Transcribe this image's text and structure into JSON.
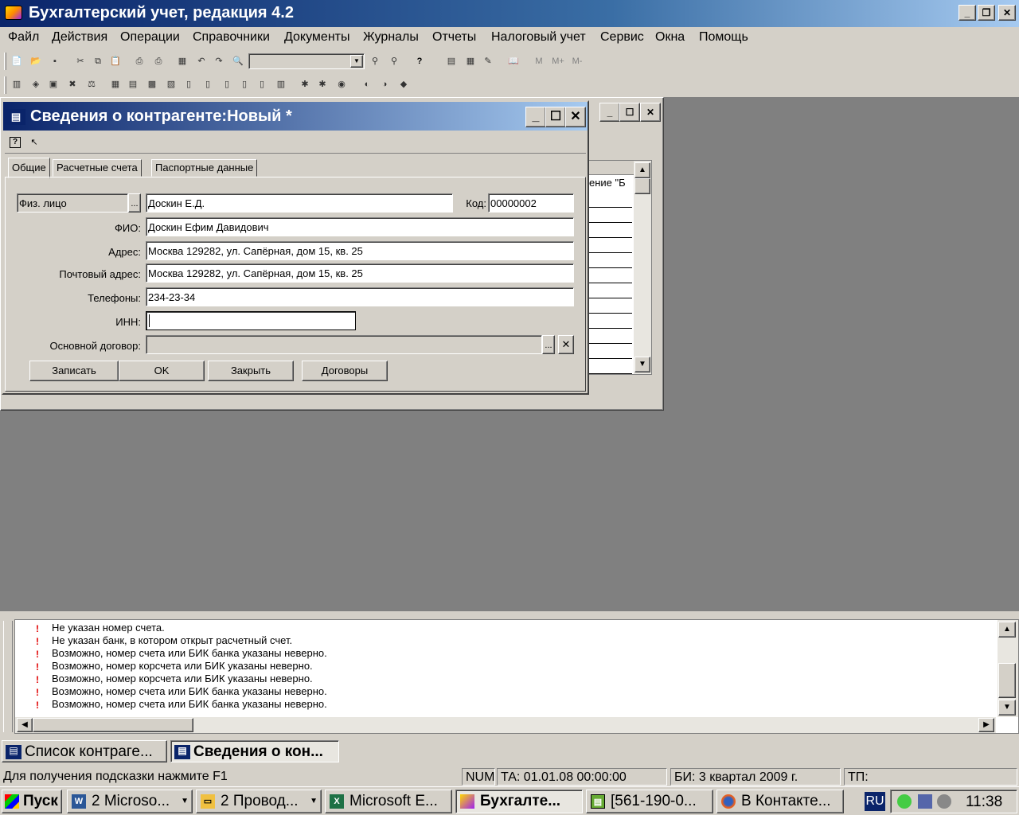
{
  "app": {
    "title": "Бухгалтерский учет, редакция 4.2"
  },
  "menu": [
    "Файл",
    "Действия",
    "Операции",
    "Справочники",
    "Документы",
    "Журналы",
    "Отчеты",
    "Налоговый учет",
    "Сервис",
    "Окна",
    "Помощь"
  ],
  "toolbar": {
    "m1": "M",
    "m2": "M+",
    "m3": "M-"
  },
  "background_window": {
    "column_fragment": "ение \"Б"
  },
  "dialog": {
    "title": "Сведения о контрагенте:Новый *",
    "tabs": [
      "Общие",
      "Расчетные счета",
      "Паспортные данные"
    ],
    "type_value": "Физ. лицо",
    "short_name": "Доскин Е.Д.",
    "code_label": "Код:",
    "code_value": "00000002",
    "fio_label": "ФИО:",
    "fio_value": "Доскин Ефим Давидович",
    "address_label": "Адрес:",
    "address_value": "Москва 129282, ул. Сапёрная, дом 15, кв. 25",
    "postal_label": "Почтовый адрес:",
    "postal_value": "Москва 129282, ул. Сапёрная, дом 15, кв. 25",
    "phones_label": "Телефоны:",
    "phones_value": "234-23-34",
    "inn_label": "ИНН:",
    "inn_value": "",
    "contract_label": "Основной договор:",
    "contract_value": "",
    "buttons": {
      "save": "Записать",
      "ok": "OK",
      "close": "Закрыть",
      "contracts": "Договоры"
    }
  },
  "messages": [
    "Не указан номер счета.",
    "Не указан банк, в котором открыт расчетный счет.",
    "Возможно, номер счета или БИК банка указаны неверно.",
    "Возможно, номер корсчета или БИК указаны неверно.",
    "Возможно, номер корсчета или БИК указаны неверно.",
    "Возможно, номер счета или БИК банка указаны неверно.",
    "Возможно, номер счета или БИК банка указаны неверно."
  ],
  "windowbar": {
    "item1": "Список контраге...",
    "item2": "Сведения о кон..."
  },
  "status": {
    "hint": "Для получения подсказки нажмите F1",
    "num": "NUM",
    "ta": "ТА: 01.01.08  00:00:00",
    "bi": "БИ: 3 квартал 2009 г.",
    "tp": "ТП:"
  },
  "taskbar": {
    "start": "Пуск",
    "word": "2 Microso...",
    "explorer": "2 Провод...",
    "excel": "Microsoft E...",
    "buh": "Бухгалте...",
    "doc": "[561-190-0...",
    "firefox": "В Контакте...",
    "lang": "RU",
    "clock": "11:38"
  }
}
